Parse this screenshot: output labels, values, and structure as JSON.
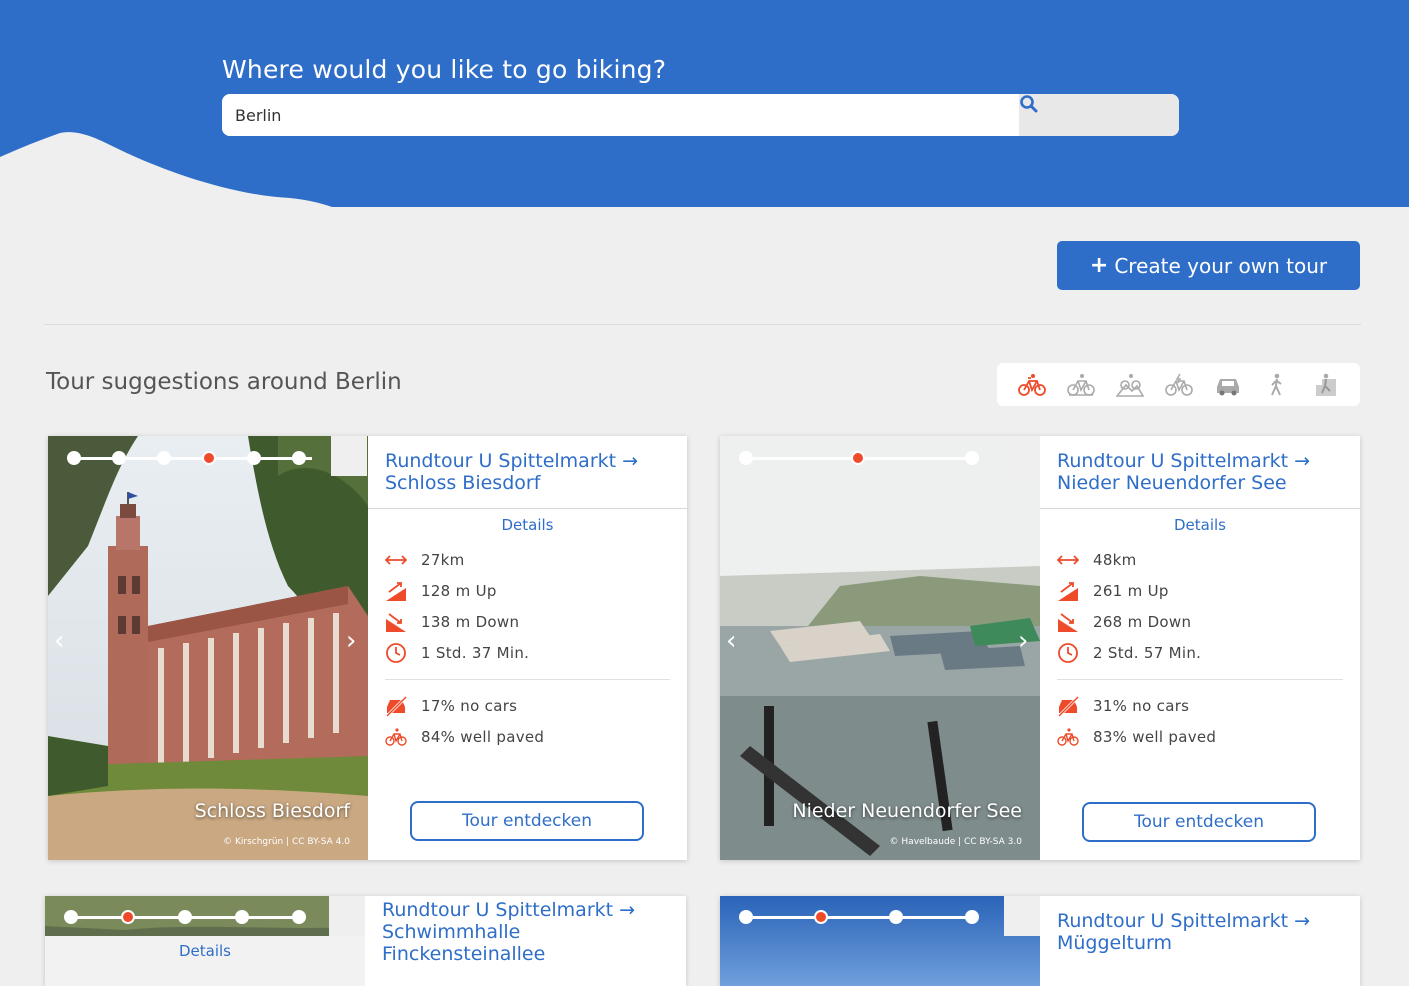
{
  "hero": {
    "title": "Where would you like to go biking?",
    "search_value": "Berlin",
    "search_icon": "search-icon"
  },
  "create_button": {
    "plus": "+",
    "label": "Create your own tour"
  },
  "section": {
    "title": "Tour suggestions around Berlin"
  },
  "modes": [
    {
      "name": "bike-icon",
      "active": true
    },
    {
      "name": "road-bike-icon",
      "active": false
    },
    {
      "name": "mountain-bike-icon",
      "active": false
    },
    {
      "name": "e-bike-icon",
      "active": false
    },
    {
      "name": "car-icon",
      "active": false
    },
    {
      "name": "hiking-icon",
      "active": false
    },
    {
      "name": "climbing-icon",
      "active": false
    }
  ],
  "cards": [
    {
      "title": "Rundtour U Spittelmarkt → Schloss Biesdorf",
      "details": "Details",
      "distance": "27km",
      "up": "128 m Up",
      "down": "138 m Down",
      "duration": "1 Std. 37 Min.",
      "no_cars": "17% no cars",
      "paved": "84% well paved",
      "button": "Tour entdecken",
      "photo_caption": "Schloss Biesdorf",
      "photo_credit": "© Kirschgrün | CC BY-SA 4.0",
      "slides": 6,
      "active_slide": 4
    },
    {
      "title": "Rundtour U Spittelmarkt → Nieder Neuendorfer See",
      "details": "Details",
      "distance": "48km",
      "up": "261 m Up",
      "down": "268 m Down",
      "duration": "2 Std. 57 Min.",
      "no_cars": "31% no cars",
      "paved": "83% well paved",
      "button": "Tour entdecken",
      "photo_caption": "Nieder Neuendorfer See",
      "photo_credit": "© Havelbaude | CC BY-SA 3.0",
      "slides": 3,
      "active_slide": 2
    },
    {
      "title": "Rundtour U Spittelmarkt → Schwimmhalle Finckensteinallee",
      "details": "Details",
      "slides": 5,
      "active_slide": 2
    },
    {
      "title": "Rundtour U Spittelmarkt → Müggelturm",
      "slides": 4,
      "active_slide": 2
    }
  ],
  "colors": {
    "brand": "#2f6ec8",
    "accent": "#ee4b2b",
    "background": "#efefef"
  }
}
